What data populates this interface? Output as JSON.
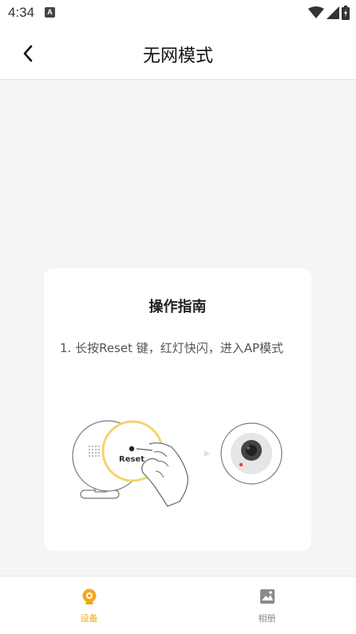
{
  "status_bar": {
    "time": "4:34",
    "notification_icon": "A"
  },
  "header": {
    "title": "无网模式",
    "back_icon": "chevron-left-icon"
  },
  "guide_card": {
    "title": "操作指南",
    "step_text": "1. 长按Reset 键，红灯快闪，进入AP模式",
    "illustration": {
      "reset_label": "Reset"
    }
  },
  "tabbar": {
    "tabs": [
      {
        "label": "设备",
        "icon": "camera-icon",
        "active": true
      },
      {
        "label": "相册",
        "icon": "image-icon",
        "active": false
      }
    ]
  },
  "colors": {
    "accent": "#f3a81c",
    "inactive": "#8a8a8a",
    "background": "#f5f5f5"
  }
}
